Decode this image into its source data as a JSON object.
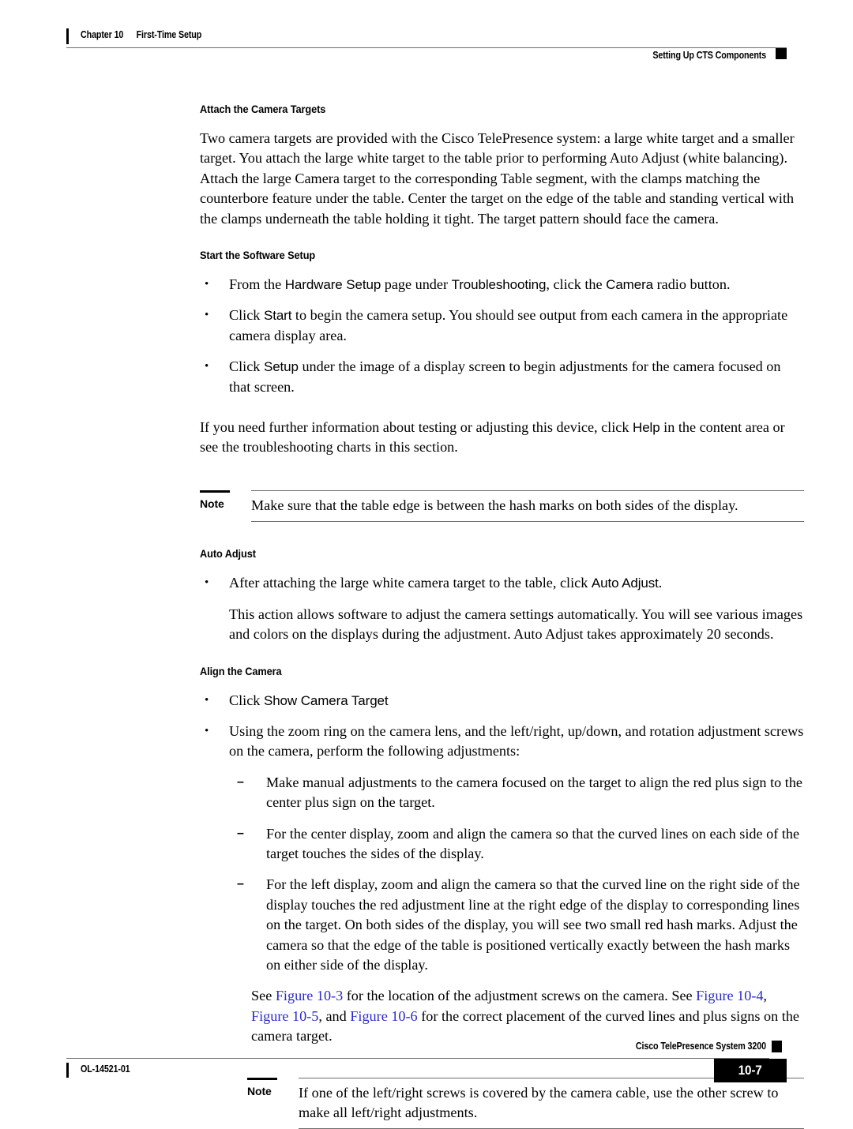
{
  "header": {
    "chapter": "Chapter 10",
    "chapter_title": "First-Time Setup",
    "running_head": "Setting Up CTS Components"
  },
  "footer": {
    "doc_id": "OL-14521-01",
    "product": "Cisco TelePresence System 3200",
    "page_number": "10-7"
  },
  "colors": {
    "link": "#2a2acd",
    "rule": "#6d6d6d",
    "text": "#000000"
  },
  "sections": {
    "attach_targets": {
      "heading": "Attach the Camera Targets",
      "paragraph": "Two camera targets are provided with the Cisco TelePresence system: a large white target and a smaller target. You attach the large white target to the table prior to performing Auto Adjust (white balancing). Attach the large Camera target to the corresponding Table segment, with the clamps matching the counterbore feature under the table. Center the target on the edge of the table and standing vertical with the clamps underneath the table holding it tight. The target pattern should face the camera."
    },
    "software_setup": {
      "heading": "Start the Software Setup",
      "bullet1": {
        "part1": "From the ",
        "ui1": "Hardware Setup",
        "part2": " page under ",
        "ui2": "Troubleshooting",
        "part3": ", click the ",
        "ui3": "Camera",
        "part4": " radio button."
      },
      "bullet2": {
        "part1": "Click ",
        "ui1": "Start",
        "part2": " to begin the camera setup. You should see output from each camera in the appropriate camera display area."
      },
      "bullet3": {
        "part1": "Click ",
        "ui1": "Setup",
        "part2": " under the image of a display screen to begin adjustments for the camera focused on that screen."
      },
      "closing": {
        "part1": "If you need further information about testing or adjusting this device, click ",
        "ui1": "Help",
        "part2": " in the content area or see the troubleshooting charts in this section."
      }
    },
    "note1": {
      "label": "Note",
      "text": "Make sure that the table edge is between the hash marks on both sides of the display."
    },
    "auto_adjust": {
      "heading": "Auto Adjust",
      "bullet1": {
        "part1": "After attaching the large white camera target to the table, click ",
        "ui1": "Auto Adjust",
        "part2": "."
      },
      "paragraph": "This action allows software to adjust the camera settings automatically. You will see various images and colors on the displays during the adjustment. Auto Adjust takes approximately 20 seconds."
    },
    "align_camera": {
      "heading": "Align the Camera",
      "bullet1": {
        "part1": "Click ",
        "ui1": "Show Camera Target"
      },
      "bullet2": "Using the zoom ring on the camera lens, and the left/right, up/down, and rotation adjustment screws on the camera, perform the following adjustments:",
      "dash1": "Make manual adjustments to the camera focused on the target to align the red plus sign to the center plus sign on the target.",
      "dash2": "For the center display, zoom and align the camera so that the curved lines on each side of the target touches the sides of the display.",
      "dash3": "For the left display, zoom and align the camera so that the curved line on the right side of the display touches the red adjustment line at the right edge of the display to corresponding lines on the target. On both sides of the display, you will see two small red hash marks. Adjust the camera so that the edge of the table is positioned vertically exactly between the hash marks on either side of the display.",
      "xref": {
        "p1": "See ",
        "link1": "Figure 10-3",
        "p2": " for the location of the adjustment screws on the camera. See ",
        "link2": "Figure 10-4",
        "p3": ", ",
        "link3": "Figure 10-5",
        "p4": ", and ",
        "link4": "Figure 10-6",
        "p5": " for the correct placement of the curved lines and plus signs on the camera target."
      }
    },
    "note2": {
      "label": "Note",
      "text": "If one of the left/right screws is covered by the camera cable, use the other screw to make all left/right adjustments."
    }
  },
  "glyphs": {
    "bullet": "•",
    "dash": "–"
  }
}
